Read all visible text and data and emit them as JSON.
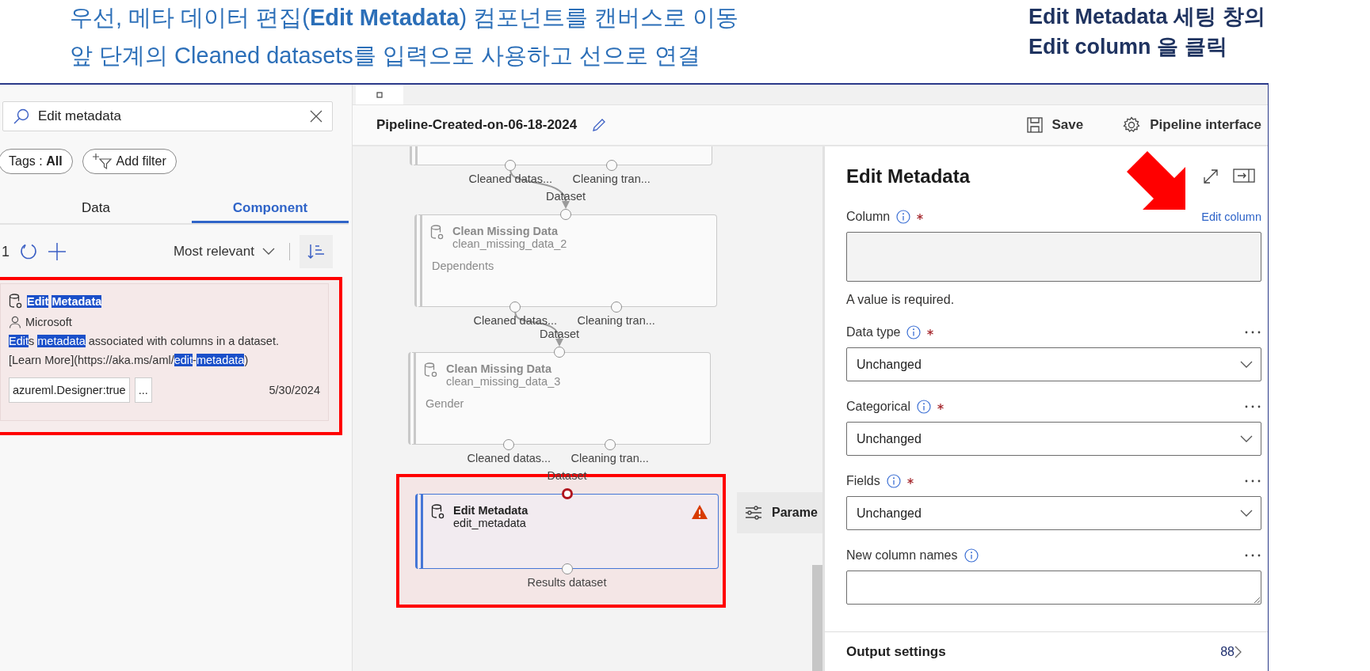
{
  "captions": {
    "left": [
      "우선, 메타 데이터 편집(**Edit Metadata**) 컴포넌트를 캔버스로 이동",
      "앞 단계의 Cleaned datasets를 입력으로 사용하고 선으로 연결"
    ],
    "right": [
      "Edit Metadata 세팅 창의",
      "Edit column 을 클릭"
    ]
  },
  "left_panel": {
    "search": {
      "value": "Edit metadata"
    },
    "chips": [
      {
        "kind": "tags",
        "label": "Tags : **All**"
      },
      {
        "kind": "filter",
        "label": "Add filter"
      }
    ],
    "tabs": [
      {
        "label": "Data",
        "selected": false
      },
      {
        "label": "Component",
        "selected": true
      }
    ],
    "count": "1",
    "sort": "Most relevant",
    "results": [
      {
        "highlighted": true,
        "title": [
          {
            "text": "Edit",
            "highlighted": true
          },
          {
            "text": "Metadata",
            "highlighted": true
          }
        ],
        "author": "Microsoft",
        "description": [
          {
            "text": "Edit",
            "highlighted": true
          },
          {
            "text": "s ",
            "highlighted": false
          },
          {
            "text": "metadata",
            "highlighted": true
          },
          {
            "text": " associated with columns in a dataset.",
            "highlighted": false
          }
        ],
        "link": [
          {
            "text": "[Learn More](https://aka.ms/aml/",
            "highlighted": false
          },
          {
            "text": "edit",
            "highlighted": true
          },
          {
            "text": "-",
            "highlighted": false
          },
          {
            "text": "metadata",
            "highlighted": true
          },
          {
            "text": ")",
            "highlighted": false
          }
        ],
        "tag": "azureml.Designer:true",
        "more": "...",
        "date": "5/30/2024"
      }
    ]
  },
  "canvas": {
    "title": "Pipeline-Created-on-06-18-2024",
    "actions": [
      {
        "kind": "save",
        "label": "Save"
      },
      {
        "kind": "settings",
        "label": "Pipeline interface"
      }
    ],
    "nodes": [
      {
        "outputs": [
          "Cleaned datas...",
          "Cleaning tran..."
        ],
        "selected": false,
        "highlighted": false
      },
      {
        "title": "Clean Missing Data",
        "name": "clean_missing_data_2",
        "detail": "Dependents",
        "input": "Dataset",
        "input_connected": true,
        "outputs": [
          "Cleaned datas...",
          "Cleaning tran..."
        ],
        "selected": false,
        "highlighted": false
      },
      {
        "title": "Clean Missing Data",
        "name": "clean_missing_data_3",
        "detail": "Gender",
        "input": "Dataset",
        "input_connected": true,
        "outputs": [
          "Cleaned datas...",
          "Cleaning tran..."
        ],
        "selected": false,
        "highlighted": false
      },
      {
        "title": "Edit Metadata",
        "name": "edit_metadata",
        "input": "Dataset",
        "input_connected": false,
        "warning": true,
        "outputs": [
          "Results dataset"
        ],
        "selected": true,
        "highlighted": true
      }
    ],
    "parameters_button": "Parame"
  },
  "panel": {
    "title": "Edit Metadata",
    "fields": [
      {
        "kind": "column_picker",
        "label": "Column",
        "required": true,
        "link": "Edit column",
        "error": "A value is required."
      },
      {
        "kind": "dropdown",
        "label": "Data type",
        "required": true,
        "value": "Unchanged"
      },
      {
        "kind": "dropdown",
        "label": "Categorical",
        "required": true,
        "value": "Unchanged"
      },
      {
        "kind": "dropdown",
        "label": "Fields",
        "required": true,
        "value": "Unchanged"
      },
      {
        "kind": "textarea",
        "label": "New column names",
        "required": false
      }
    ],
    "output_settings": {
      "label": "Output settings",
      "count": "88"
    }
  }
}
